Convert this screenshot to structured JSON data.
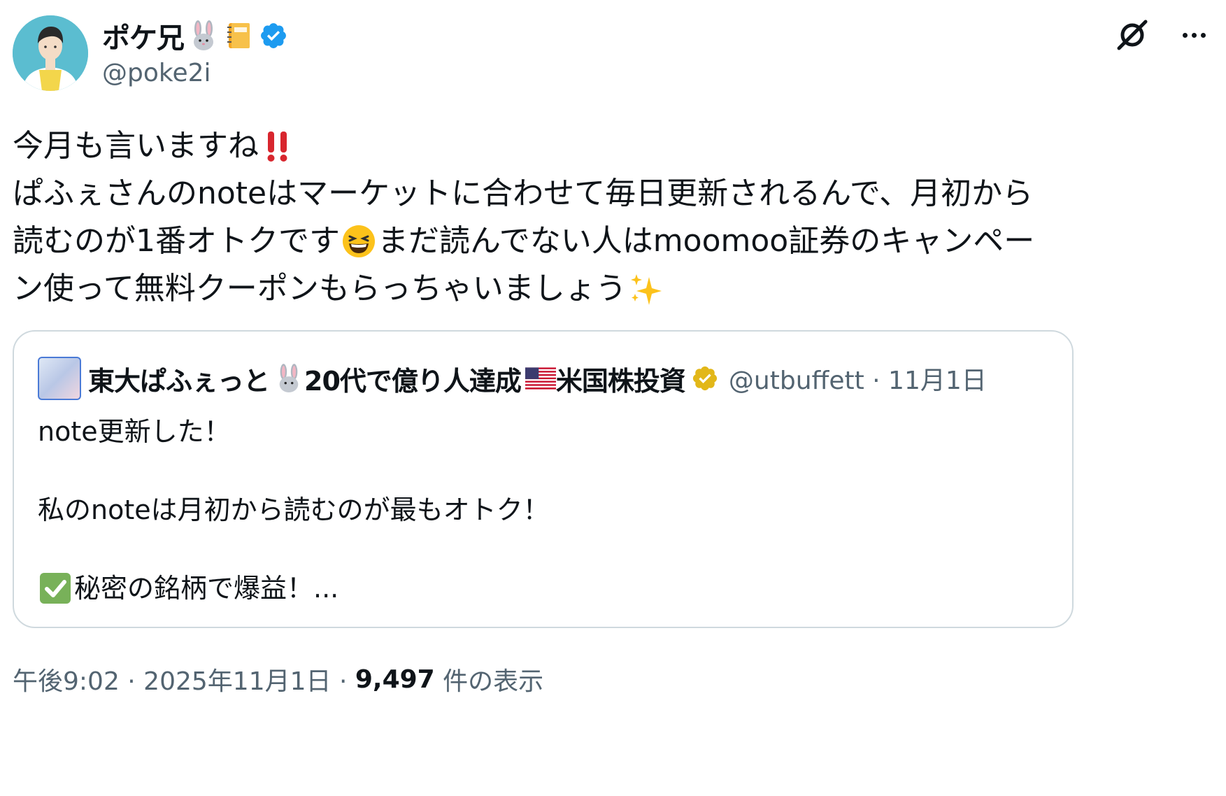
{
  "author": {
    "display_name": "ポケ兄",
    "handle": "@poke2i",
    "name_emojis": [
      "rabbit-face-icon",
      "notebook-icon"
    ],
    "verified": true
  },
  "actions": {
    "grok_icon": "grok-icon",
    "more_icon": "more-options-icon"
  },
  "tweet": {
    "line1": "今月も言いますね",
    "line2": "ぱふぇさんのnoteはマーケットに合わせて毎日更新されるんで、月初から",
    "line3a": "読むのが1番オトクです",
    "line3b": "まだ読んでない人はmoomoo証券のキャンペー",
    "line4": "ン使って無料クーポンもらっちゃいましょう"
  },
  "quote": {
    "name_a": "東大ぱふぇっと",
    "name_b": "20代で億り人達成",
    "name_c": "米国株投資",
    "meta": "@utbuffett · 11月1日",
    "body_line1": "note更新した！",
    "body_line2": "私のnoteは月初から読むのが最もオトク！",
    "body_line3": "秘密の銘柄で爆益！..."
  },
  "footer": {
    "time": "午後9:02 · 2025年11月1日 · ",
    "views": "9,497",
    "views_label": " 件の表示"
  },
  "colors": {
    "verified_blue": "#1d9bf0",
    "verified_gold": "#e2b719",
    "muted": "#536471",
    "border": "#cfd9de"
  }
}
